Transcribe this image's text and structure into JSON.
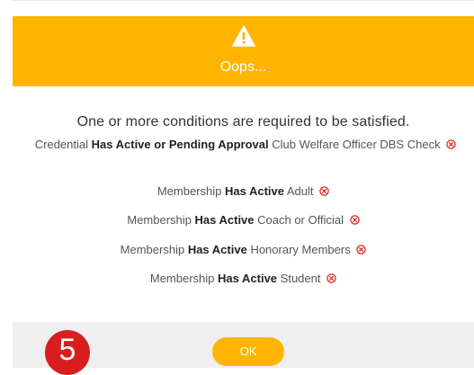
{
  "header": {
    "icon": "warning-icon",
    "title": "Oops..."
  },
  "body": {
    "heading": "One or more conditions are required to be satisfied.",
    "conditions": [
      {
        "prefix": "Credential",
        "status": "Has Active or Pending Approval",
        "item": "Club Welfare Officer DBS Check",
        "icon": "x-circle-icon"
      },
      {
        "prefix": "Membership",
        "status": "Has Active",
        "item": "Adult",
        "icon": "x-circle-icon"
      },
      {
        "prefix": "Membership",
        "status": "Has Active",
        "item": "Coach or Official",
        "icon": "x-circle-icon"
      },
      {
        "prefix": "Membership",
        "status": "Has Active",
        "item": "Honorary Members",
        "icon": "x-circle-icon"
      },
      {
        "prefix": "Membership",
        "status": "Has Active",
        "item": "Student",
        "icon": "x-circle-icon"
      }
    ]
  },
  "footer": {
    "ok_label": "OK"
  },
  "annotation": {
    "step_number": "5"
  },
  "colors": {
    "accent": "#ffb400",
    "error": "#e02424",
    "badge": "#d81e1e"
  }
}
